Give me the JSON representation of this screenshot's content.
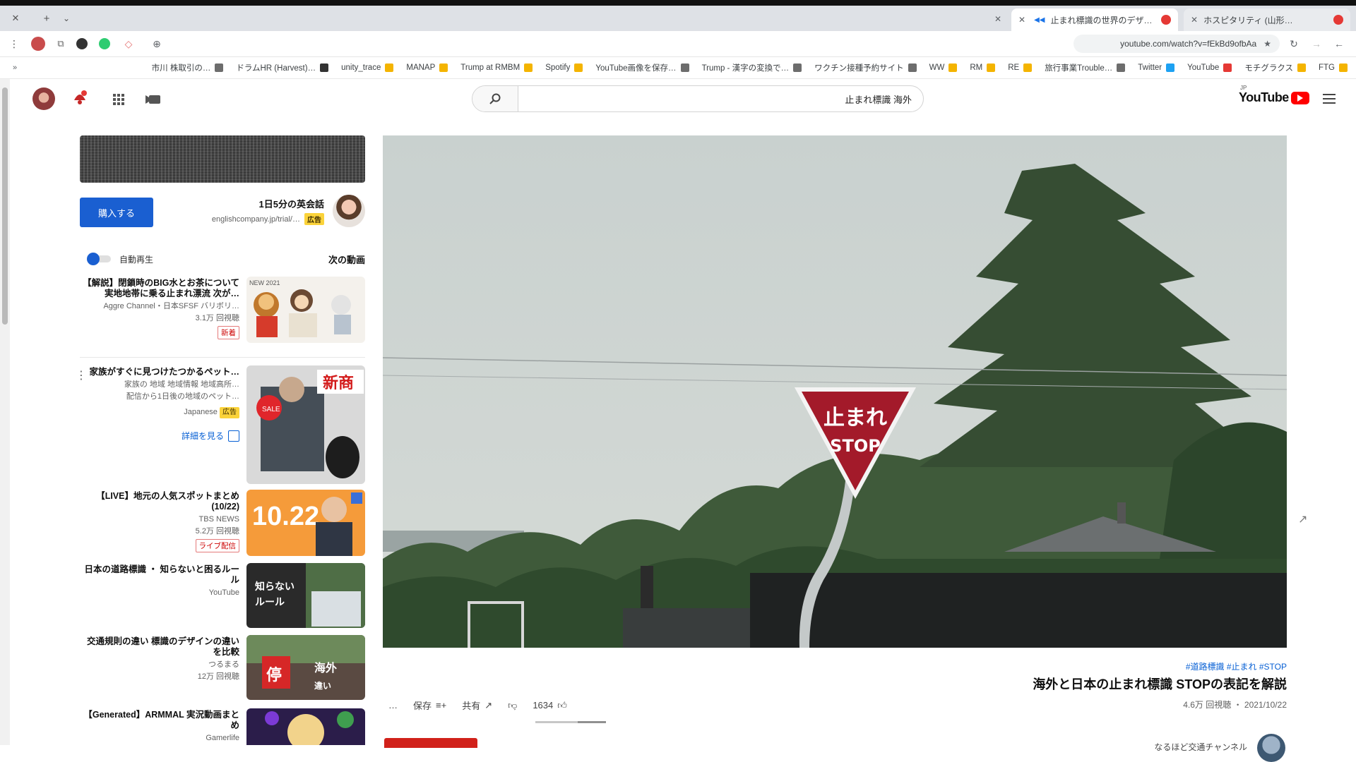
{
  "browser": {
    "tabs": [
      {
        "title": "ホスピタリティ (山形…",
        "favicon_color": "#e53935",
        "active": false
      },
      {
        "title": "止まれ標識の世界のデザ…",
        "favicon_color": "#e53935",
        "active": true
      }
    ],
    "address": "youtube.com/watch?v=fEkBd9ofbAa",
    "extension_colors": [
      "#c94c4c",
      "#7a7a7a",
      "#333333",
      "#2ecc71",
      "#e57373"
    ]
  },
  "bookmarks": [
    {
      "label": "FTG",
      "icon_color": "#f4b400"
    },
    {
      "label": "モチグラクス",
      "icon_color": "#f4b400"
    },
    {
      "label": "YouTube",
      "icon_color": "#e53935"
    },
    {
      "label": "Twitter",
      "icon_color": "#1da1f2"
    },
    {
      "label": "旅行事業Trouble…",
      "icon_color": "#6d6d6d"
    },
    {
      "label": "RE",
      "icon_color": "#f4b400"
    },
    {
      "label": "RM",
      "icon_color": "#f4b400"
    },
    {
      "label": "WW",
      "icon_color": "#f4b400"
    },
    {
      "label": "ワクチン接種予約サイト",
      "icon_color": "#6d6d6d"
    },
    {
      "label": "Trump - 漢字の変換で…",
      "icon_color": "#6d6d6d"
    },
    {
      "label": "YouTube画像を保存…",
      "icon_color": "#6d6d6d"
    },
    {
      "label": "Spotify",
      "icon_color": "#f4b400"
    },
    {
      "label": "Trump at RMBM",
      "icon_color": "#f4b400"
    },
    {
      "label": "MANAP",
      "icon_color": "#f4b400"
    },
    {
      "label": "unity_trace",
      "icon_color": "#f4b400"
    },
    {
      "label": "ドラムHR (Harvest)…",
      "icon_color": "#333333"
    },
    {
      "label": "市川 株取引の…",
      "icon_color": "#6d6d6d"
    }
  ],
  "header": {
    "search_value": "止まれ標識 海外",
    "logo_text": "YouTube",
    "logo_country": "JP"
  },
  "ad": {
    "title": "1日5分の英会話",
    "advertiser": "englishcompany.jp/trial/…",
    "badge": "広告",
    "cta": "購入する"
  },
  "upnext": {
    "label": "次の動画",
    "autoplay_label": "自動再生"
  },
  "sidebar": [
    {
      "title": "【解説】閉鎖時のBIG水とお茶について 実地地帯に乗る止まれ漂流 次が…",
      "channel": "Aggre Channel・日本SFSF バリボリ…",
      "meta": "3.1万 回視聴",
      "badge": "新着",
      "thumb": "toys"
    },
    {
      "title": "家族がすぐに見つけたつかるペット…",
      "channel": "家族の 地域 地域情報 地域高所…",
      "meta": "配信から1日後の地域のペット…",
      "badge": "",
      "sponsor": "Japanese",
      "ad_label": "広告",
      "cta": "詳細を見る",
      "thumb": "coat"
    },
    {
      "title": "【LIVE】地元の人気スポットまとめ (10/22)",
      "channel": "TBS NEWS",
      "meta": "5.2万 回視聴",
      "badge": "ライブ配信",
      "thumb": "orange"
    },
    {
      "title": "日本の道路標識 ・ 知らないと困るルール",
      "channel": "YouTube",
      "meta": "",
      "badge": "",
      "thumb": "dark"
    },
    {
      "title": "交通規則の違い 標識のデザインの違いを比較",
      "channel": "つるまる",
      "meta": "12万 回視聴",
      "badge": "",
      "thumb": "redjp"
    },
    {
      "title": "【Generated】ARMMAL 実況動画まとめ",
      "channel": "Gamerlife",
      "meta": "",
      "badge": "",
      "thumb": "anime"
    }
  ],
  "video": {
    "sign_text_jp": "止まれ",
    "sign_text_en": "STOP",
    "hashtags": "#道路標識 #止まれ #STOP",
    "title": "海外と日本の止まれ標識 STOPの表記を解説",
    "meta": "4.6万 回視聴 ・ 2021/10/22",
    "likes": "1634",
    "share_label": "共有",
    "save_label": "保存",
    "more_label": "…",
    "owner": "なるほど交通チャンネル"
  }
}
